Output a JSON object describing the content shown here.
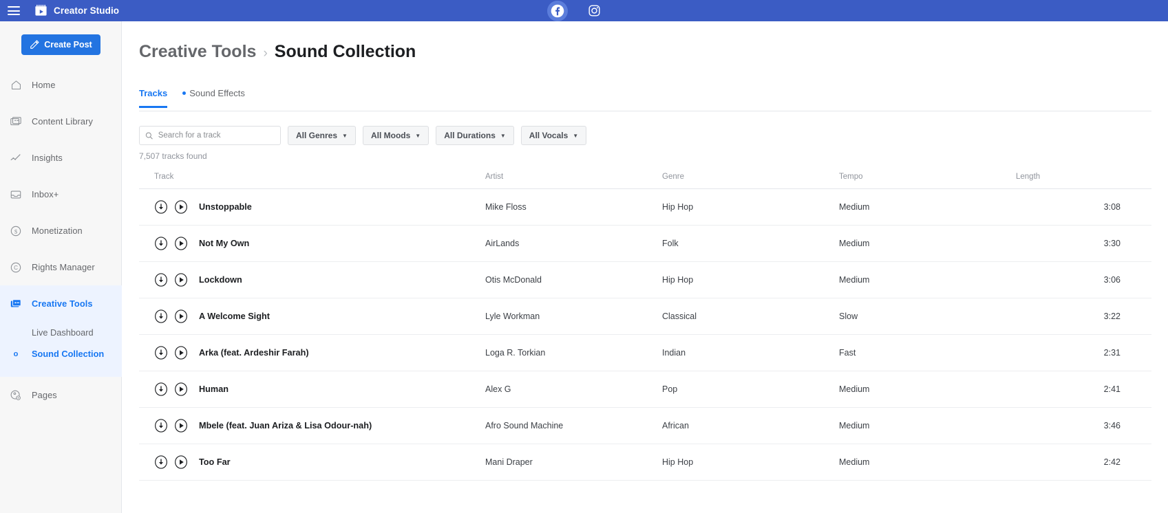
{
  "topbar": {
    "menu_icon": "hamburger-menu-icon",
    "brand_name": "Creator Studio",
    "brand_logo_icon": "creator-studio-logo-icon",
    "social": [
      {
        "name": "facebook-icon",
        "label": "Facebook",
        "active": true
      },
      {
        "name": "instagram-icon",
        "label": "Instagram",
        "active": false
      }
    ]
  },
  "sidebar": {
    "create_post_label": "Create Post",
    "create_post_icon": "compose-icon",
    "items": [
      {
        "label": "Home",
        "icon": "home-icon",
        "active": false
      },
      {
        "label": "Content Library",
        "icon": "library-icon",
        "active": false
      },
      {
        "label": "Insights",
        "icon": "insights-chart-icon",
        "active": false
      },
      {
        "label": "Inbox+",
        "icon": "inbox-icon",
        "active": false
      },
      {
        "label": "Monetization",
        "icon": "dollar-icon",
        "active": false
      },
      {
        "label": "Rights Manager",
        "icon": "copyright-icon",
        "active": false
      },
      {
        "label": "Creative Tools",
        "icon": "creative-tools-icon",
        "active": true
      }
    ],
    "sub_items": [
      {
        "label": "Live Dashboard",
        "active": false,
        "bullet": ""
      },
      {
        "label": "Sound Collection",
        "active": true,
        "bullet": "o"
      }
    ],
    "trailing_items": [
      {
        "label": "Pages",
        "icon": "pages-icon",
        "active": false
      }
    ]
  },
  "main": {
    "breadcrumb": {
      "parent": "Creative Tools",
      "separator": "›",
      "current": "Sound Collection"
    },
    "tabs": [
      {
        "label": "Tracks",
        "active": true,
        "badge": false
      },
      {
        "label": "Sound Effects",
        "active": false,
        "badge": true
      }
    ],
    "search": {
      "placeholder": "Search for a track",
      "value": "",
      "icon": "search-icon"
    },
    "filters": [
      {
        "label": "All Genres",
        "name": "genre-filter"
      },
      {
        "label": "All Moods",
        "name": "mood-filter"
      },
      {
        "label": "All Durations",
        "name": "duration-filter"
      },
      {
        "label": "All Vocals",
        "name": "vocals-filter"
      }
    ],
    "result_count": "7,507 tracks found",
    "table": {
      "columns": [
        "Track",
        "Artist",
        "Genre",
        "Tempo",
        "Length"
      ],
      "rows": [
        {
          "track": "Unstoppable",
          "artist": "Mike Floss",
          "genre": "Hip Hop",
          "tempo": "Medium",
          "length": "3:08"
        },
        {
          "track": "Not My Own",
          "artist": "AirLands",
          "genre": "Folk",
          "tempo": "Medium",
          "length": "3:30"
        },
        {
          "track": "Lockdown",
          "artist": "Otis McDonald",
          "genre": "Hip Hop",
          "tempo": "Medium",
          "length": "3:06"
        },
        {
          "track": "A Welcome Sight",
          "artist": "Lyle Workman",
          "genre": "Classical",
          "tempo": "Slow",
          "length": "3:22"
        },
        {
          "track": "Arka (feat. Ardeshir Farah)",
          "artist": "Loga R. Torkian",
          "genre": "Indian",
          "tempo": "Fast",
          "length": "2:31"
        },
        {
          "track": "Human",
          "artist": "Alex G",
          "genre": "Pop",
          "tempo": "Medium",
          "length": "2:41"
        },
        {
          "track": "Mbele (feat. Juan Ariza & Lisa Odour-nah)",
          "artist": "Afro Sound Machine",
          "genre": "African",
          "tempo": "Medium",
          "length": "3:46"
        },
        {
          "track": "Too Far",
          "artist": "Mani Draper",
          "genre": "Hip Hop",
          "tempo": "Medium",
          "length": "2:42"
        }
      ],
      "row_icons": [
        "download-icon",
        "play-icon"
      ]
    }
  },
  "colors": {
    "topbar_blue": "#3b5cc4",
    "accent_blue": "#1877f2",
    "button_blue": "#2374e1",
    "sidebar_bg": "#f7f7f7",
    "active_nav_bg": "#edf3ff",
    "text_dark": "#1c1e21",
    "text_muted": "#65676b"
  }
}
